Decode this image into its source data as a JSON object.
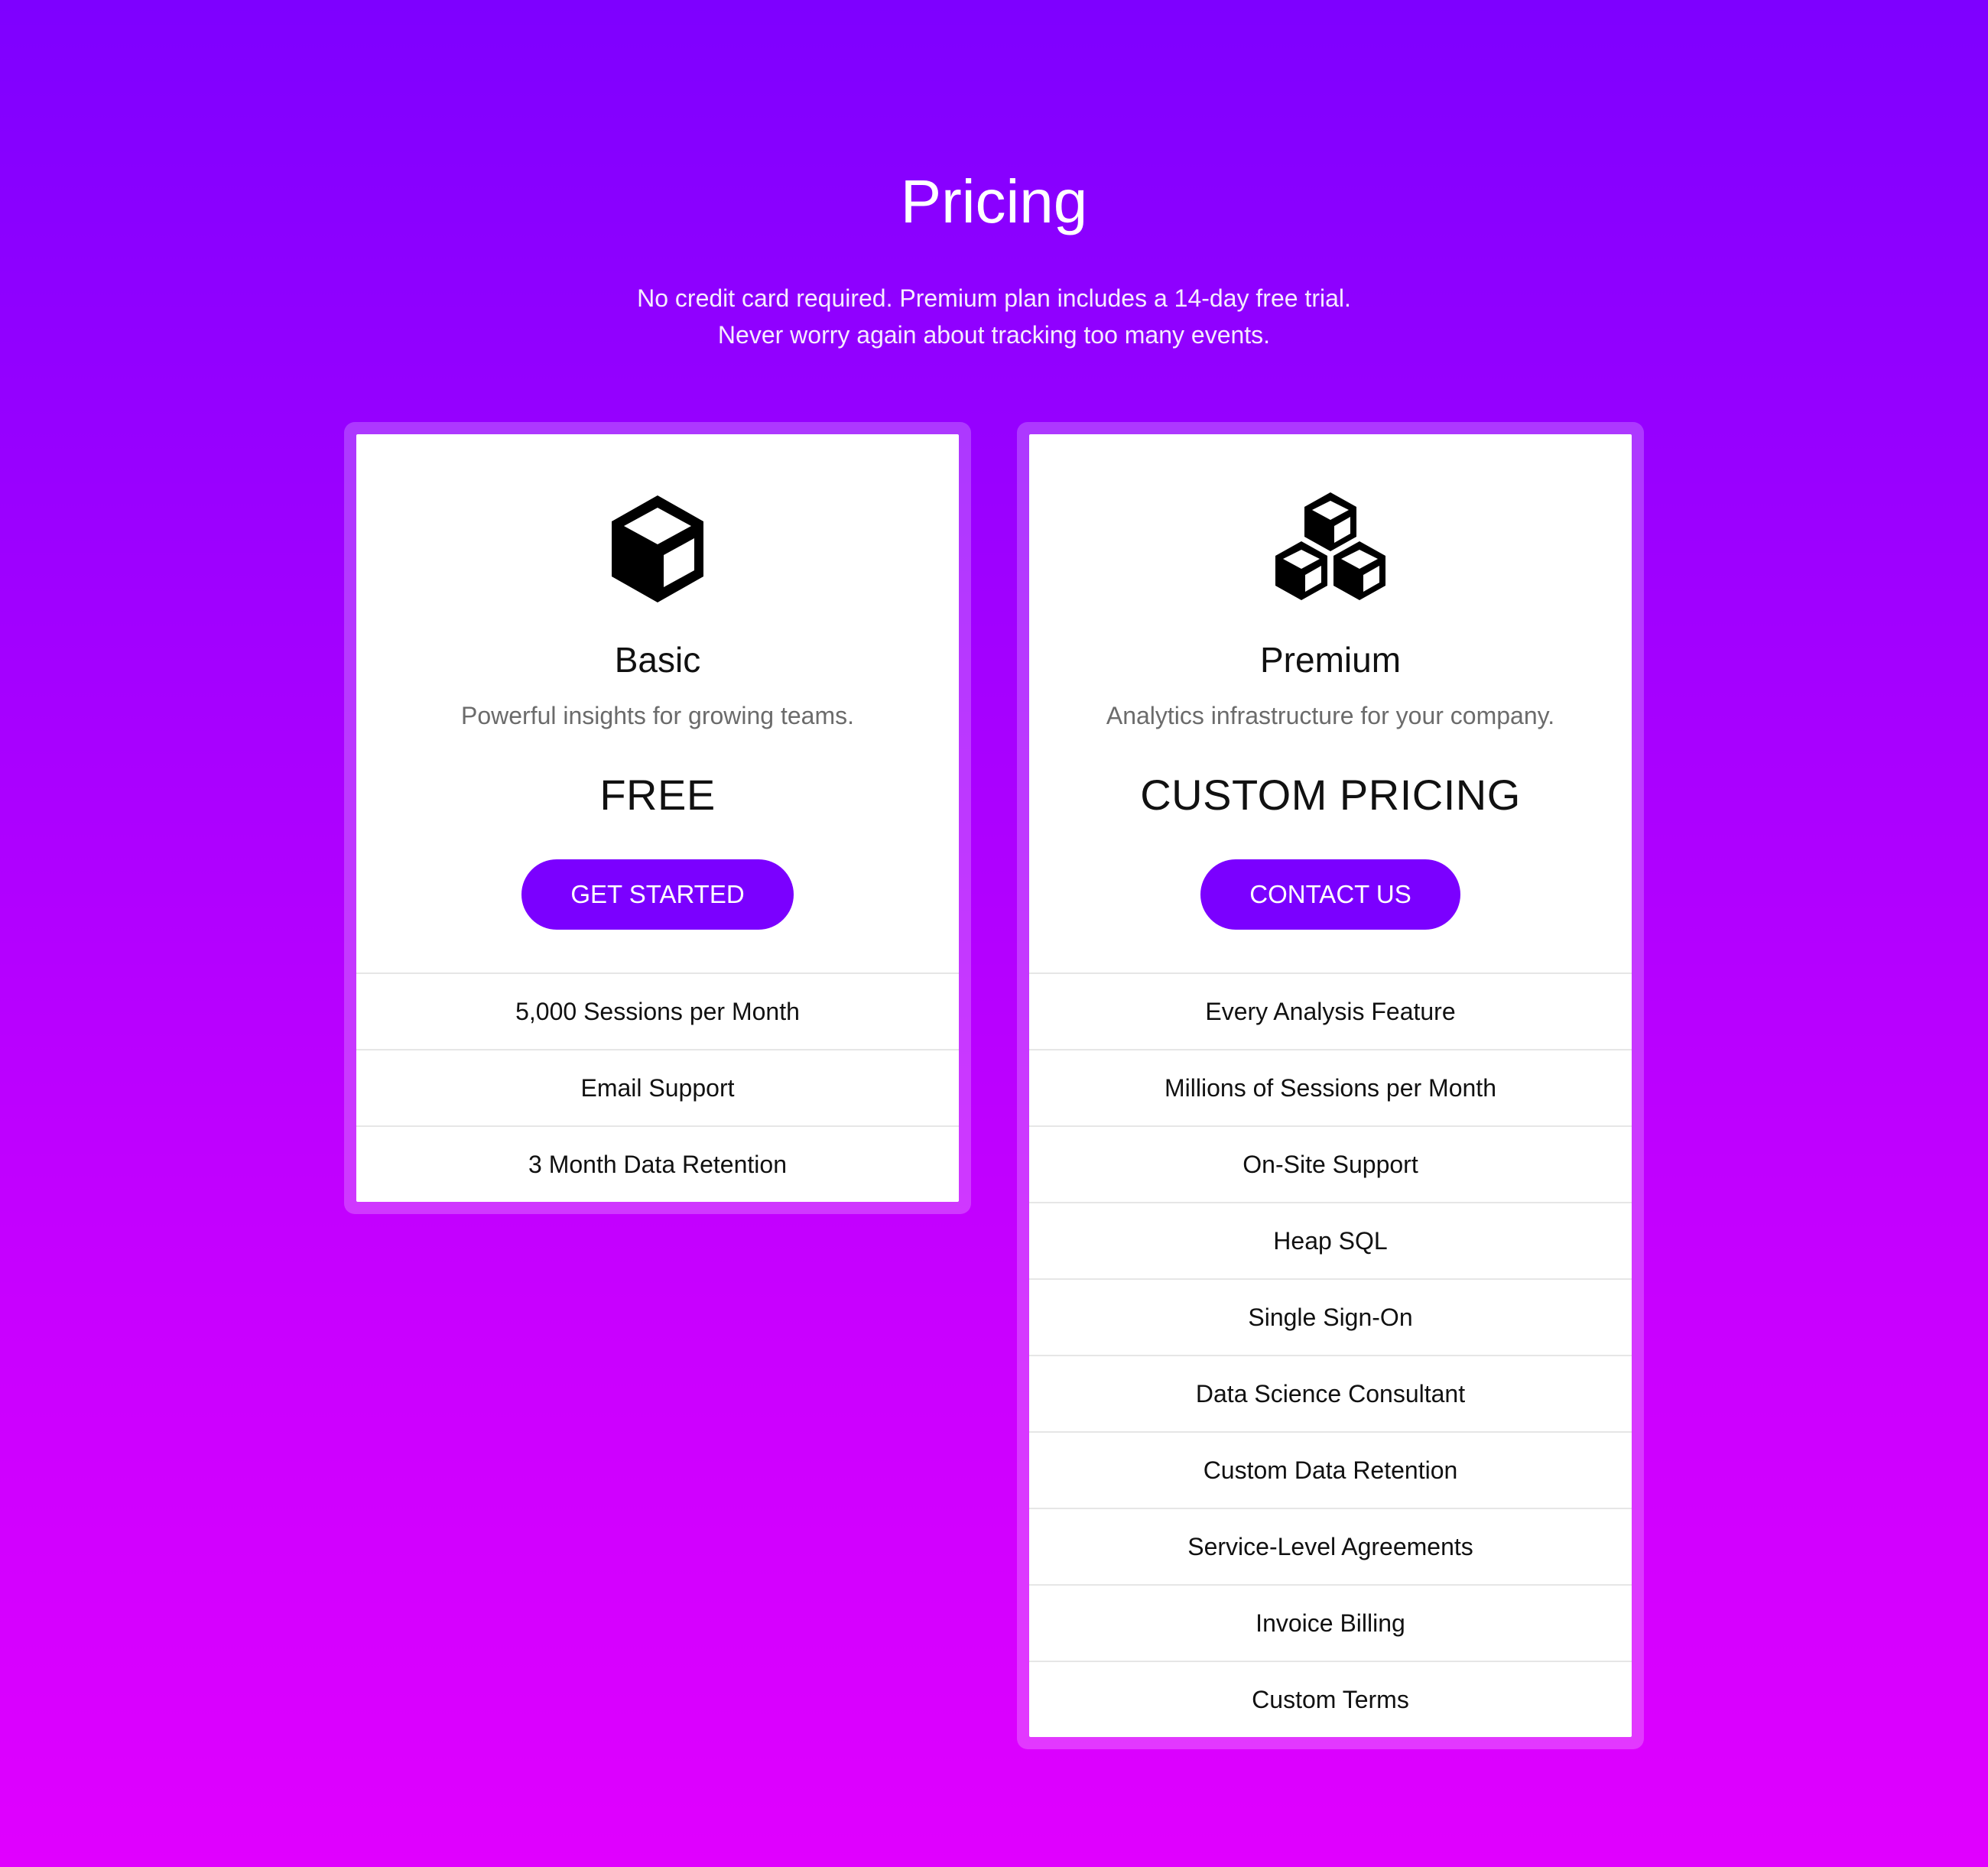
{
  "hero": {
    "title": "Pricing",
    "subtitle_line1": "No credit card required. Premium plan includes a 14-day free trial.",
    "subtitle_line2": "Never worry again about tracking too many events."
  },
  "plans": [
    {
      "icon": "cube-icon",
      "name": "Basic",
      "description": "Powerful insights for growing teams.",
      "price": "FREE",
      "cta_label": "GET STARTED",
      "features": [
        "5,000 Sessions per Month",
        "Email Support",
        "3 Month Data Retention"
      ]
    },
    {
      "icon": "cubes-icon",
      "name": "Premium",
      "description": "Analytics infrastructure for your company.",
      "price": "CUSTOM PRICING",
      "cta_label": "CONTACT US",
      "features": [
        "Every Analysis Feature",
        "Millions of Sessions per Month",
        "On-Site Support",
        "Heap SQL",
        "Single Sign-On",
        "Data Science Consultant",
        "Custom Data Retention",
        "Service-Level Agreements",
        "Invoice Billing",
        "Custom Terms"
      ]
    }
  ],
  "colors": {
    "accent": "#7b00ff",
    "gradient_top": "#7e00ff",
    "gradient_bottom": "#e000ff"
  }
}
